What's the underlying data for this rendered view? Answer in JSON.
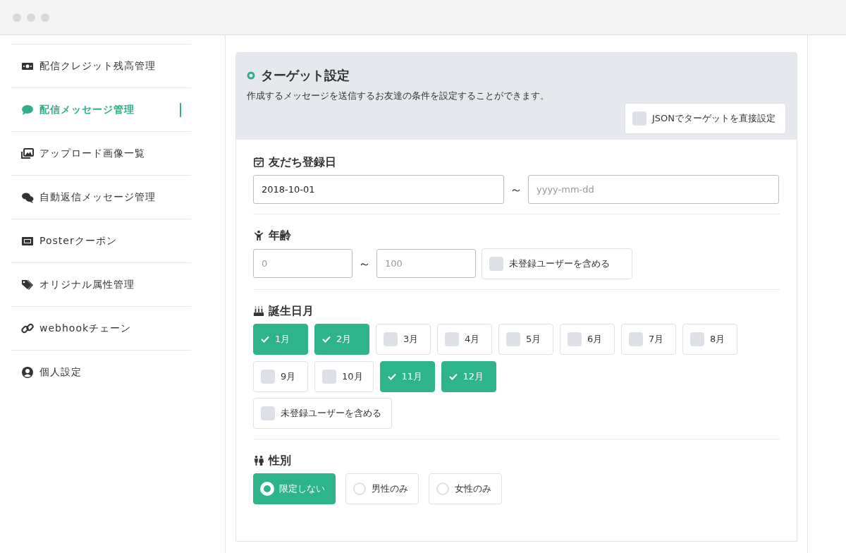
{
  "sidebar": {
    "items": [
      {
        "label": "配信クレジット残高管理",
        "selected": false
      },
      {
        "label": "配信メッセージ管理",
        "selected": true
      },
      {
        "label": "アップロード画像一覧",
        "selected": false
      },
      {
        "label": "自動返信メッセージ管理",
        "selected": false
      },
      {
        "label": "Posterクーポン",
        "selected": false
      },
      {
        "label": "オリジナル属性管理",
        "selected": false
      },
      {
        "label": "webhookチェーン",
        "selected": false
      },
      {
        "label": "個人設定",
        "selected": false
      }
    ]
  },
  "target": {
    "title": "ターゲット設定",
    "description": "作成するメッセージを送信するお友達の条件を設定することができます。",
    "json_toggle": {
      "label": "JSONでターゲットを直接設定",
      "checked": false
    },
    "sections": [
      {
        "kind": "date_range",
        "title": "友だち登録日",
        "from": {
          "value": "2018-10-01"
        },
        "separator": "～",
        "to": {
          "placeholder": "yyyy-mm-dd"
        }
      },
      {
        "kind": "number_range",
        "title": "年齢",
        "from": {
          "placeholder": "0"
        },
        "separator": "～",
        "to": {
          "placeholder": "100"
        },
        "include_unregistered": {
          "label": "未登録ユーザーを含める",
          "checked": false
        }
      },
      {
        "kind": "month_checks",
        "title": "誕生日月",
        "options": [
          {
            "label": "1月",
            "checked": true
          },
          {
            "label": "2月",
            "checked": true
          },
          {
            "label": "3月",
            "checked": false
          },
          {
            "label": "4月",
            "checked": false
          },
          {
            "label": "5月",
            "checked": false
          },
          {
            "label": "6月",
            "checked": false
          },
          {
            "label": "7月",
            "checked": false
          },
          {
            "label": "8月",
            "checked": false
          },
          {
            "label": "9月",
            "checked": false
          },
          {
            "label": "10月",
            "checked": false
          },
          {
            "label": "11月",
            "checked": true
          },
          {
            "label": "12月",
            "checked": true
          }
        ],
        "include_unregistered": {
          "label": "未登録ユーザーを含める",
          "checked": false
        }
      },
      {
        "kind": "radio",
        "title": "性別",
        "options": [
          {
            "label": "限定しない",
            "selected": true
          },
          {
            "label": "男性のみ",
            "selected": false
          },
          {
            "label": "女性のみ",
            "selected": false
          }
        ]
      }
    ]
  }
}
